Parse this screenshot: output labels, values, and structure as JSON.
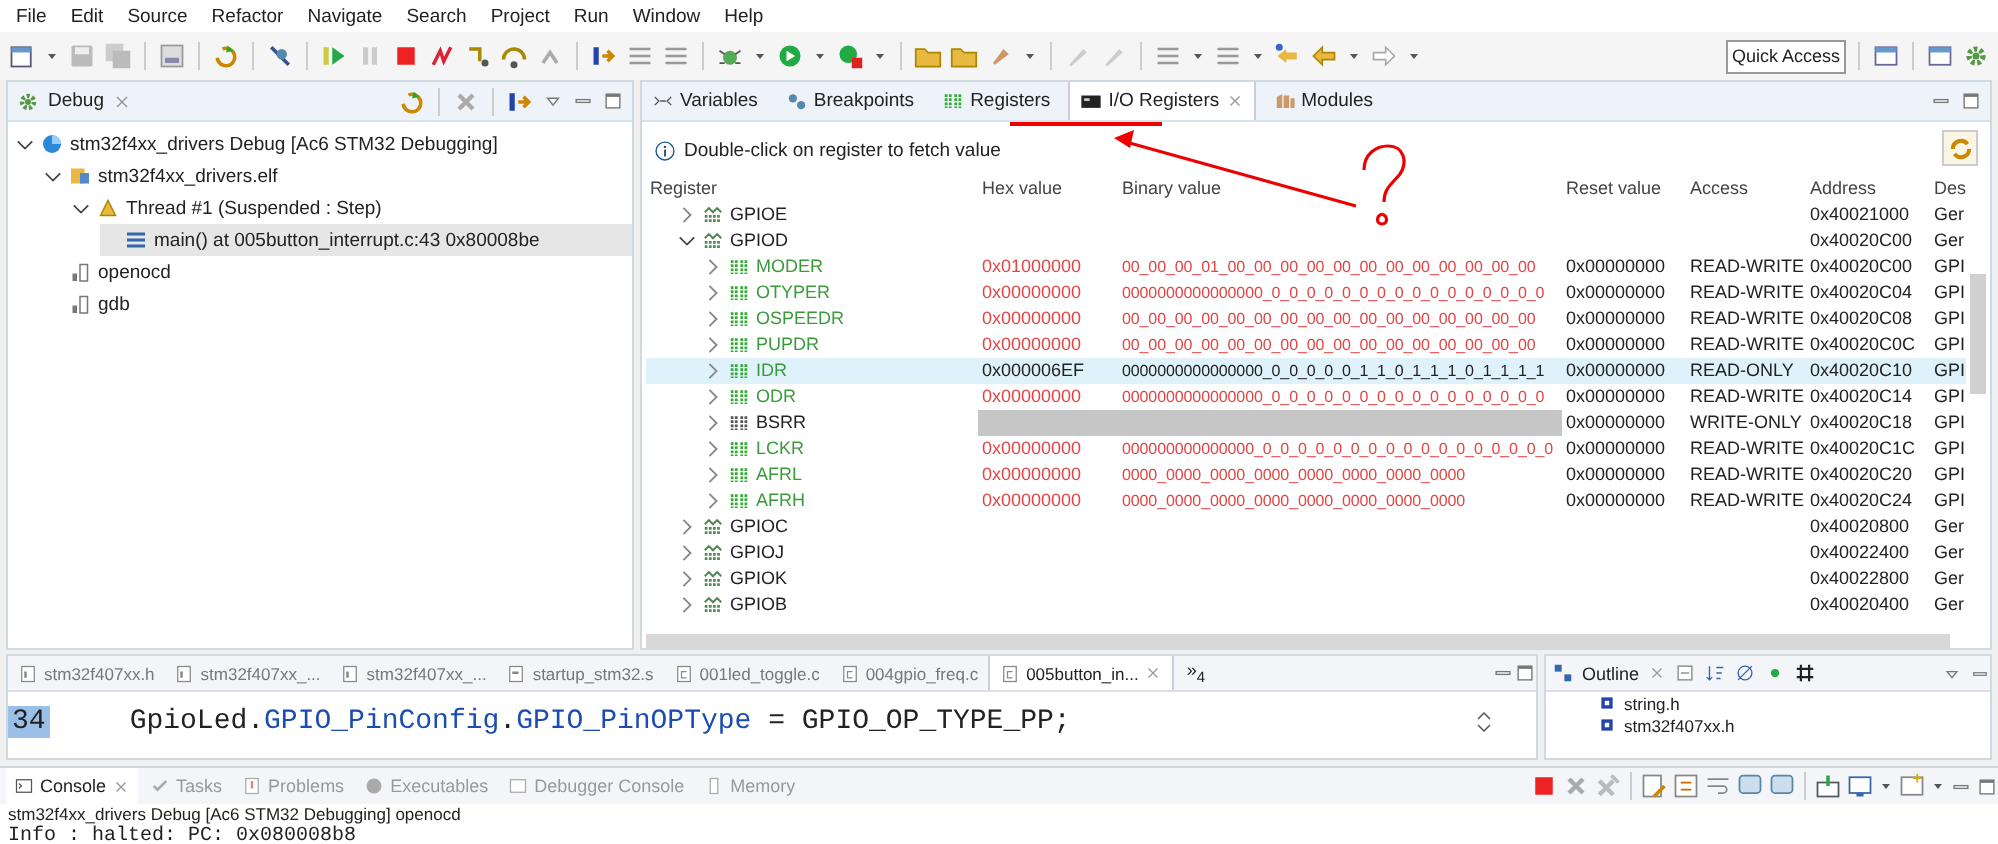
{
  "menu": [
    "File",
    "Edit",
    "Source",
    "Refactor",
    "Navigate",
    "Search",
    "Project",
    "Run",
    "Window",
    "Help"
  ],
  "quick_access": {
    "placeholder": "Quick Access"
  },
  "debug": {
    "title": "Debug",
    "tree": [
      {
        "kind": "launch",
        "label": "stm32f4xx_drivers Debug [Ac6 STM32 Debugging]",
        "expanded": true,
        "selected": false,
        "children": [
          {
            "kind": "elf",
            "label": "stm32f4xx_drivers.elf",
            "expanded": true,
            "selected": false,
            "children": [
              {
                "kind": "thread",
                "label": "Thread #1 (Suspended : Step)",
                "expanded": true,
                "selected": false,
                "children": [
                  {
                    "kind": "frame",
                    "label": "main() at 005button_interrupt.c:43 0x80008be",
                    "selected": true
                  }
                ]
              }
            ]
          },
          {
            "kind": "process",
            "label": "openocd",
            "selected": false
          },
          {
            "kind": "process",
            "label": "gdb",
            "selected": false
          }
        ]
      }
    ]
  },
  "io_registers": {
    "tabs": [
      {
        "kind": "variables",
        "label": "Variables",
        "selected": false
      },
      {
        "kind": "breakpoints",
        "label": "Breakpoints",
        "selected": false
      },
      {
        "kind": "registers",
        "label": "Registers",
        "selected": false
      },
      {
        "kind": "io",
        "label": "I/O Registers",
        "selected": true
      },
      {
        "kind": "modules",
        "label": "Modules",
        "selected": false
      }
    ],
    "info": "Double-click on register to fetch value",
    "columns": [
      "Register",
      "Hex value",
      "Binary value",
      "Reset value",
      "Access",
      "Address",
      "Des"
    ],
    "rows": [
      {
        "kind": "peripheral",
        "name": "GPIOE",
        "expanded": false,
        "selected": false,
        "address": "0x40021000",
        "description": "Ger"
      },
      {
        "kind": "peripheral",
        "name": "GPIOD",
        "expanded": true,
        "selected": false,
        "address": "0x40020C00",
        "description": "Ger",
        "children": [
          {
            "kind": "register",
            "name": "MODER",
            "fetched": true,
            "selected": false,
            "hex": "0x01000000",
            "binary": "00_00_00_01_00_00_00_00_00_00_00_00_00_00_00_00",
            "reset": "0x00000000",
            "access": "READ-WRITE",
            "address": "0x40020C00",
            "description": "GPI"
          },
          {
            "kind": "register",
            "name": "OTYPER",
            "fetched": true,
            "selected": false,
            "hex": "0x00000000",
            "binary": "0000000000000000_0_0_0_0_0_0_0_0_0_0_0_0_0_0_0_0",
            "reset": "0x00000000",
            "access": "READ-WRITE",
            "address": "0x40020C04",
            "description": "GPI"
          },
          {
            "kind": "register",
            "name": "OSPEEDR",
            "fetched": true,
            "selected": false,
            "hex": "0x00000000",
            "binary": "00_00_00_00_00_00_00_00_00_00_00_00_00_00_00_00",
            "reset": "0x00000000",
            "access": "READ-WRITE",
            "address": "0x40020C08",
            "description": "GPI"
          },
          {
            "kind": "register",
            "name": "PUPDR",
            "fetched": true,
            "selected": false,
            "hex": "0x00000000",
            "binary": "00_00_00_00_00_00_00_00_00_00_00_00_00_00_00_00",
            "reset": "0x00000000",
            "access": "READ-WRITE",
            "address": "0x40020C0C",
            "description": "GPI"
          },
          {
            "kind": "register",
            "name": "IDR",
            "fetched": true,
            "selected": true,
            "hex": "0x000006EF",
            "binary": "0000000000000000_0_0_0_0_0_1_1_0_1_1_1_0_1_1_1_1",
            "reset": "0x00000000",
            "access": "READ-ONLY",
            "address": "0x40020C10",
            "description": "GPI"
          },
          {
            "kind": "register",
            "name": "ODR",
            "fetched": true,
            "selected": false,
            "hex": "0x00000000",
            "binary": "0000000000000000_0_0_0_0_0_0_0_0_0_0_0_0_0_0_0_0",
            "reset": "0x00000000",
            "access": "READ-WRITE",
            "address": "0x40020C14",
            "description": "GPI"
          },
          {
            "kind": "register",
            "name": "BSRR",
            "fetched": false,
            "selected": false,
            "reset": "0x00000000",
            "access": "WRITE-ONLY",
            "address": "0x40020C18",
            "description": "GPI"
          },
          {
            "kind": "register",
            "name": "LCKR",
            "fetched": true,
            "selected": false,
            "hex": "0x00000000",
            "binary": "000000000000000_0_0_0_0_0_0_0_0_0_0_0_0_0_0_0_0_0",
            "reset": "0x00000000",
            "access": "READ-WRITE",
            "address": "0x40020C1C",
            "description": "GPI"
          },
          {
            "kind": "register",
            "name": "AFRL",
            "fetched": true,
            "selected": false,
            "hex": "0x00000000",
            "binary": "0000_0000_0000_0000_0000_0000_0000_0000",
            "reset": "0x00000000",
            "access": "READ-WRITE",
            "address": "0x40020C20",
            "description": "GPI"
          },
          {
            "kind": "register",
            "name": "AFRH",
            "fetched": true,
            "selected": false,
            "hex": "0x00000000",
            "binary": "0000_0000_0000_0000_0000_0000_0000_0000",
            "reset": "0x00000000",
            "access": "READ-WRITE",
            "address": "0x40020C24",
            "description": "GPI"
          }
        ]
      },
      {
        "kind": "peripheral",
        "name": "GPIOC",
        "expanded": false,
        "selected": false,
        "address": "0x40020800",
        "description": "Ger"
      },
      {
        "kind": "peripheral",
        "name": "GPIOJ",
        "expanded": false,
        "selected": false,
        "address": "0x40022400",
        "description": "Ger"
      },
      {
        "kind": "peripheral",
        "name": "GPIOK",
        "expanded": false,
        "selected": false,
        "address": "0x40022800",
        "description": "Ger"
      },
      {
        "kind": "peripheral",
        "name": "GPIOB",
        "expanded": false,
        "selected": false,
        "address": "0x40020400",
        "description": "Ger"
      }
    ]
  },
  "editor": {
    "tabs": [
      {
        "kind": "header",
        "label": "stm32f407xx.h",
        "selected": false
      },
      {
        "kind": "header",
        "label": "stm32f407xx_...",
        "selected": false
      },
      {
        "kind": "header",
        "label": "stm32f407xx_...",
        "selected": false
      },
      {
        "kind": "asm",
        "label": "startup_stm32.s",
        "selected": false
      },
      {
        "kind": "source",
        "label": "001led_toggle.c",
        "selected": false
      },
      {
        "kind": "source",
        "label": "004gpio_freq.c",
        "selected": false
      },
      {
        "kind": "source",
        "label": "005button_in...",
        "selected": true
      }
    ],
    "overflow": "»$_{4}$",
    "line_number": "34",
    "code": [
      {
        "kind": "plain",
        "text": "GpioLed."
      },
      {
        "kind": "field",
        "text": "GPIO_PinConfig"
      },
      {
        "kind": "plain",
        "text": "."
      },
      {
        "kind": "field",
        "text": "GPIO_PinOPType"
      },
      {
        "kind": "plain",
        "text": " = GPIO_OP_TYPE_PP;"
      }
    ]
  },
  "outline": {
    "title": "Outline",
    "items": [
      "string.h",
      "stm32f407xx.h"
    ]
  },
  "console": {
    "tabs": [
      {
        "label": "Console",
        "selected": true
      },
      {
        "label": "Tasks",
        "selected": false
      },
      {
        "label": "Problems",
        "selected": false
      },
      {
        "label": "Executables",
        "selected": false
      },
      {
        "label": "Debugger Console",
        "selected": false
      },
      {
        "label": "Memory",
        "selected": false
      }
    ],
    "header": "stm32f4xx_drivers Debug [Ac6 STM32 Debugging] openocd",
    "lines": [
      "Info : halted: PC: 0x080008b8"
    ]
  }
}
